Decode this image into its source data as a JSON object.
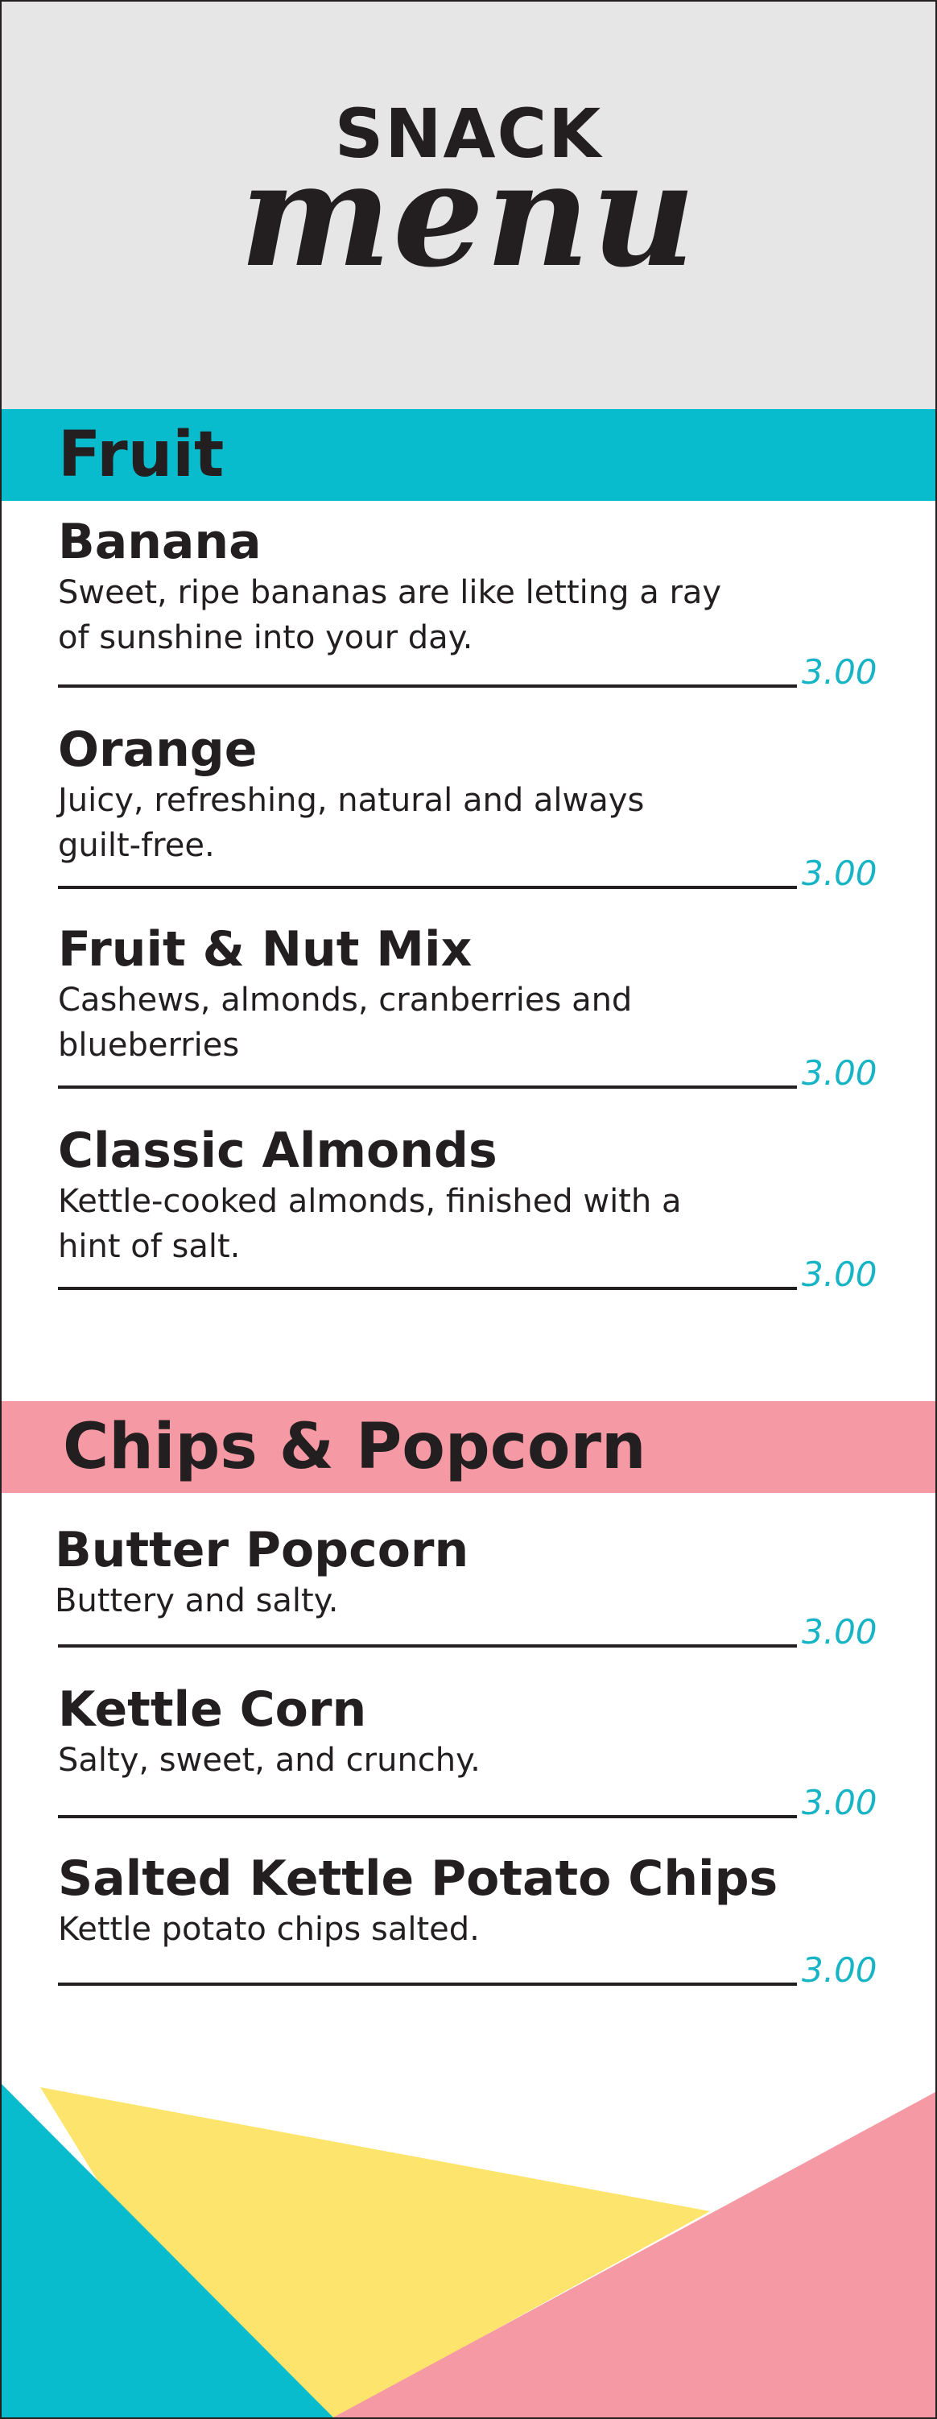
{
  "header": {
    "title_top": "SNACK",
    "title_bottom": "menu"
  },
  "colors": {
    "header_bg": "#e6e6e7",
    "fruit_bar": "#09bccd",
    "chips_bar": "#f59aa5",
    "price": "#17b4c6",
    "yellow": "#fde56d",
    "text": "#231f20"
  },
  "sections": [
    {
      "title": "Fruit",
      "items": [
        {
          "name": "Banana",
          "description": "Sweet, ripe bananas are like letting a ray of sunshine into your day.",
          "price": "3.00"
        },
        {
          "name": "Orange",
          "description": "Juicy, refreshing, natural and always guilt-free.",
          "price": "3.00"
        },
        {
          "name": "Fruit & Nut Mix",
          "description": "Cashews, almonds, cranberries and blueberries",
          "price": "3.00"
        },
        {
          "name": "Classic Almonds",
          "description": "Kettle-cooked almonds, finished with a hint of salt.",
          "price": "3.00"
        }
      ]
    },
    {
      "title": "Chips & Popcorn",
      "items": [
        {
          "name": "Butter Popcorn",
          "description": "Buttery and salty.",
          "price": "3.00"
        },
        {
          "name": "Kettle Corn",
          "description": "Salty, sweet, and crunchy.",
          "price": "3.00"
        },
        {
          "name": "Salted Kettle Potato Chips",
          "description": "Kettle potato chips salted.",
          "price": "3.00"
        }
      ]
    }
  ]
}
